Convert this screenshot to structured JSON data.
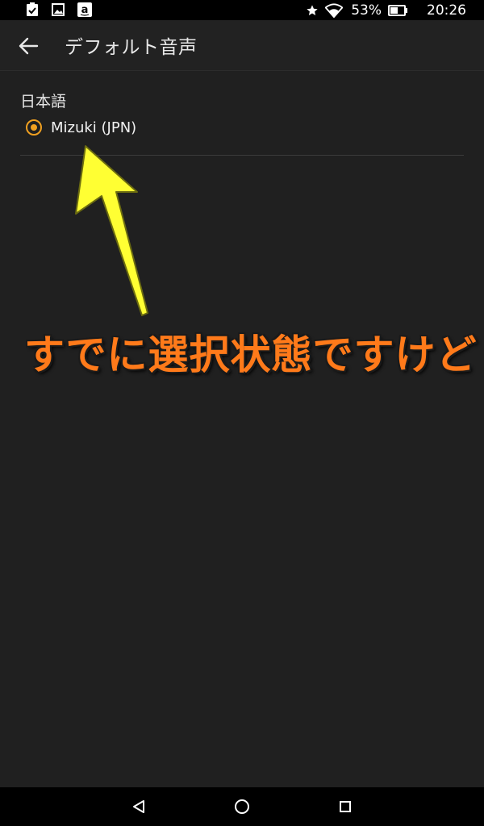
{
  "status_bar": {
    "left_icons": [
      "checklist-icon",
      "image-icon",
      "amazon-icon"
    ],
    "battery": "53%",
    "time": "20:26"
  },
  "app_bar": {
    "title": "デフォルト音声"
  },
  "content": {
    "section_header": "日本語",
    "options": [
      {
        "label": "Mizuki (JPN)",
        "selected": true
      }
    ]
  },
  "annotation": {
    "text": "すでに選択状態ですけど",
    "text_color": "#ff7a1a",
    "arrow_color": "#ffff33"
  },
  "nav_bar": {
    "buttons": [
      "back-triangle-icon",
      "home-circle-icon",
      "recents-square-icon"
    ]
  },
  "colors": {
    "background": "#202020",
    "accent": "#f0a020",
    "status_bar": "#000000"
  }
}
